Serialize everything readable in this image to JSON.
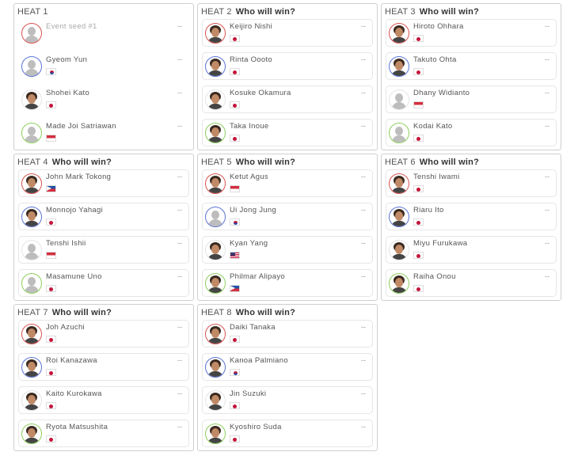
{
  "prompt": "Who will win?",
  "empty_score": "--",
  "colors": {
    "ring_1": "#d9534f",
    "ring_2": "#5b74d6",
    "ring_3": "#e4e4e4",
    "ring_4": "#8ccf5c"
  },
  "heats": [
    {
      "label": "HEAT 1",
      "prompt": "",
      "athletes": [
        {
          "name": "Event seed #1",
          "flag": "",
          "photo": false,
          "seed": true,
          "score": "--"
        },
        {
          "name": "Gyeom Yun",
          "flag": "kr",
          "photo": false,
          "score": "--"
        },
        {
          "name": "Shohei Kato",
          "flag": "jp",
          "photo": true,
          "score": "--"
        },
        {
          "name": "Made Joi Satriawan",
          "flag": "id",
          "photo": false,
          "score": "--"
        }
      ]
    },
    {
      "label": "HEAT 2",
      "prompt": "Who will win?",
      "athletes": [
        {
          "name": "Keijiro Nishi",
          "flag": "jp",
          "photo": true,
          "score": "--"
        },
        {
          "name": "Rinta Oooto",
          "flag": "jp",
          "photo": true,
          "score": "--"
        },
        {
          "name": "Kosuke Okamura",
          "flag": "jp",
          "photo": true,
          "score": "--"
        },
        {
          "name": "Taka Inoue",
          "flag": "jp",
          "photo": true,
          "score": "--"
        }
      ]
    },
    {
      "label": "HEAT 3",
      "prompt": "Who will win?",
      "athletes": [
        {
          "name": "Hiroto Ohhara",
          "flag": "jp",
          "photo": true,
          "score": "--"
        },
        {
          "name": "Takuto Ohta",
          "flag": "jp",
          "photo": true,
          "score": "--"
        },
        {
          "name": "Dhany Widianto",
          "flag": "id",
          "photo": false,
          "score": "--"
        },
        {
          "name": "Kodai Kato",
          "flag": "jp",
          "photo": false,
          "score": "--"
        }
      ]
    },
    {
      "label": "HEAT 4",
      "prompt": "Who will win?",
      "athletes": [
        {
          "name": "John Mark Tokong",
          "flag": "ph",
          "photo": true,
          "score": "--"
        },
        {
          "name": "Monnojo Yahagi",
          "flag": "jp",
          "photo": true,
          "score": "--"
        },
        {
          "name": "Tenshi Ishii",
          "flag": "id",
          "photo": false,
          "score": "--"
        },
        {
          "name": "Masamune Uno",
          "flag": "jp",
          "photo": false,
          "score": "--"
        }
      ]
    },
    {
      "label": "HEAT 5",
      "prompt": "Who will win?",
      "athletes": [
        {
          "name": "Ketut Agus",
          "flag": "id",
          "photo": true,
          "score": "--"
        },
        {
          "name": "Ui Jong Jung",
          "flag": "kr",
          "photo": false,
          "score": "--"
        },
        {
          "name": "Kyan Yang",
          "flag": "us",
          "photo": true,
          "score": "--"
        },
        {
          "name": "Philmar Alipayo",
          "flag": "ph",
          "photo": true,
          "score": "--"
        }
      ]
    },
    {
      "label": "HEAT 6",
      "prompt": "Who will win?",
      "athletes": [
        {
          "name": "Tenshi Iwami",
          "flag": "jp",
          "photo": true,
          "score": "--"
        },
        {
          "name": "Riaru Ito",
          "flag": "jp",
          "photo": true,
          "score": "--"
        },
        {
          "name": "Miyu Furukawa",
          "flag": "jp",
          "photo": true,
          "score": "--"
        },
        {
          "name": "Raiha Onou",
          "flag": "jp",
          "photo": true,
          "score": "--"
        }
      ]
    },
    {
      "label": "HEAT 7",
      "prompt": "Who will win?",
      "athletes": [
        {
          "name": "Joh Azuchi",
          "flag": "jp",
          "photo": true,
          "score": "--"
        },
        {
          "name": "Roi Kanazawa",
          "flag": "jp",
          "photo": true,
          "score": "--"
        },
        {
          "name": "Kaito Kurokawa",
          "flag": "jp",
          "photo": true,
          "score": "--"
        },
        {
          "name": "Ryota Matsushita",
          "flag": "jp",
          "photo": true,
          "score": "--"
        }
      ]
    },
    {
      "label": "HEAT 8",
      "prompt": "Who will win?",
      "athletes": [
        {
          "name": "Daiki Tanaka",
          "flag": "jp",
          "photo": true,
          "score": "--"
        },
        {
          "name": "Kanoa Palmiano",
          "flag": "kr",
          "photo": true,
          "score": "--"
        },
        {
          "name": "Jin Suzuki",
          "flag": "jp",
          "photo": true,
          "score": "--"
        },
        {
          "name": "Kyoshiro Suda",
          "flag": "jp",
          "photo": true,
          "score": "--"
        }
      ]
    }
  ]
}
